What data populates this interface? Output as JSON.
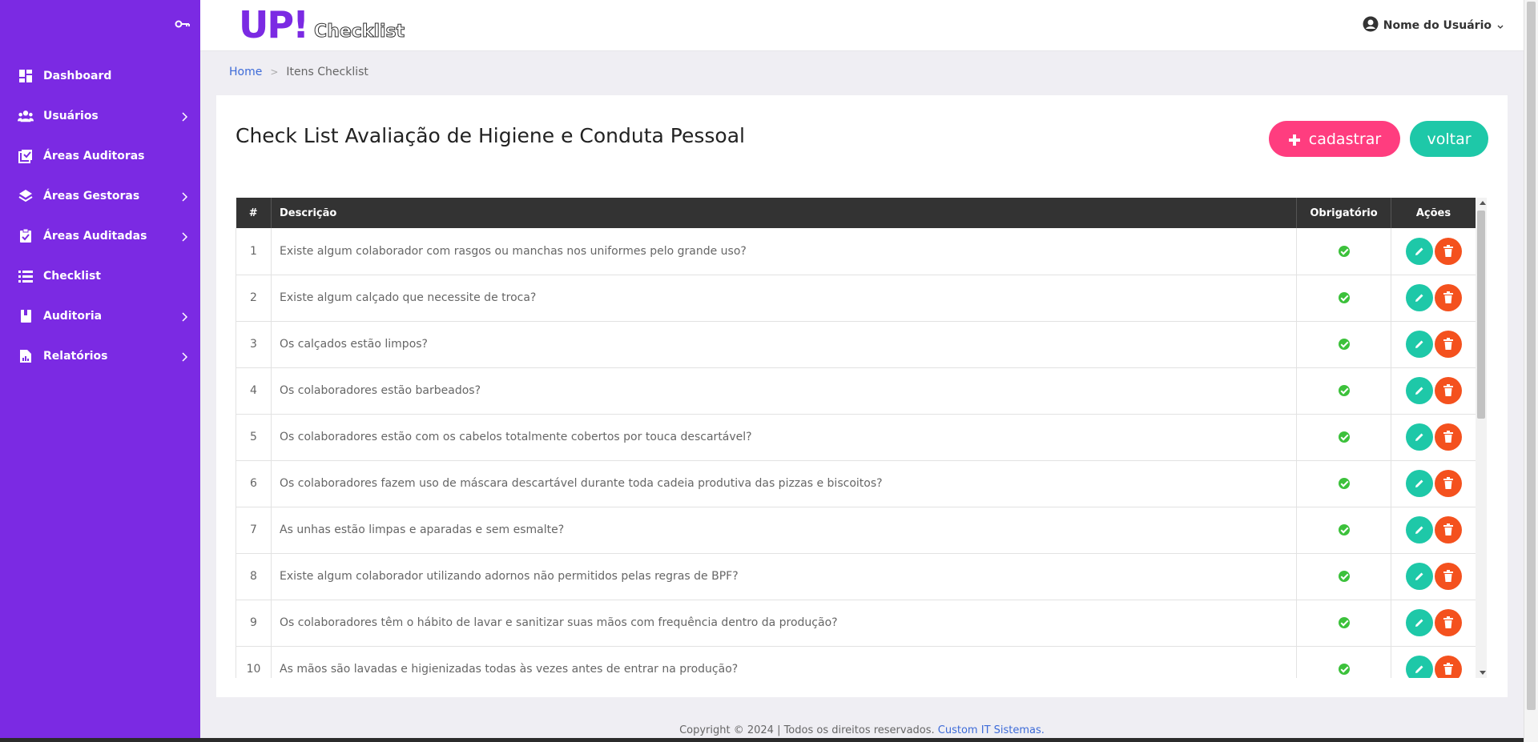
{
  "sidebar": {
    "toggle_icon": "key-toggle-icon",
    "items": [
      {
        "label": "Dashboard",
        "icon": "dashboard-icon",
        "has_submenu": false
      },
      {
        "label": "Usuários",
        "icon": "users-icon",
        "has_submenu": true
      },
      {
        "label": "Áreas Auditoras",
        "icon": "checkbox-list-icon",
        "has_submenu": false
      },
      {
        "label": "Áreas Gestoras",
        "icon": "layers-icon",
        "has_submenu": true
      },
      {
        "label": "Áreas Auditadas",
        "icon": "clipboard-check-icon",
        "has_submenu": true
      },
      {
        "label": "Checklist",
        "icon": "list-icon",
        "has_submenu": false
      },
      {
        "label": "Auditoria",
        "icon": "book-icon",
        "has_submenu": true
      },
      {
        "label": "Relatórios",
        "icon": "report-icon",
        "has_submenu": true
      }
    ]
  },
  "header": {
    "logo_up": "UP!",
    "logo_checklist": "Checklist",
    "user_name": "Nome do Usuário"
  },
  "breadcrumb": {
    "home": "Home",
    "separator": ">",
    "current": "Itens Checklist"
  },
  "main": {
    "title": "Check List Avaliação de Higiene e Conduta Pessoal",
    "cadastrar_label": "cadastrar",
    "voltar_label": "voltar",
    "table": {
      "headers": {
        "num": "#",
        "desc": "Descrição",
        "req": "Obrigatório",
        "act": "Ações"
      },
      "rows": [
        {
          "num": "1",
          "desc": "Existe algum colaborador com rasgos ou manchas nos uniformes pelo grande uso?",
          "required": true
        },
        {
          "num": "2",
          "desc": "Existe algum calçado que necessite de troca?",
          "required": true
        },
        {
          "num": "3",
          "desc": "Os calçados estão limpos?",
          "required": true
        },
        {
          "num": "4",
          "desc": "Os colaboradores estão barbeados?",
          "required": true
        },
        {
          "num": "5",
          "desc": "Os colaboradores estão com os cabelos totalmente cobertos por touca descartável?",
          "required": true
        },
        {
          "num": "6",
          "desc": "Os colaboradores fazem uso de máscara descartável durante toda cadeia produtiva das pizzas e biscoitos?",
          "required": true
        },
        {
          "num": "7",
          "desc": "As unhas estão limpas e aparadas e sem esmalte?",
          "required": true
        },
        {
          "num": "8",
          "desc": "Existe algum colaborador utilizando adornos não permitidos pelas regras de BPF?",
          "required": true
        },
        {
          "num": "9",
          "desc": "Os colaboradores têm o hábito de lavar e sanitizar suas mãos com frequência dentro da produção?",
          "required": true
        },
        {
          "num": "10",
          "desc": "As mãos são lavadas e higienizadas todas às vezes antes de entrar na produção?",
          "required": true
        }
      ]
    }
  },
  "footer": {
    "text": "Copyright © 2024 | Todos os direitos reservados. ",
    "link": "Custom IT Sistemas."
  },
  "colors": {
    "sidebar": "#7b2ae3",
    "accent_pink": "#ff3d7f",
    "accent_teal": "#1ec8a8",
    "delete_orange": "#f4511e",
    "check_green": "#3cc13b",
    "table_header": "#333333"
  }
}
